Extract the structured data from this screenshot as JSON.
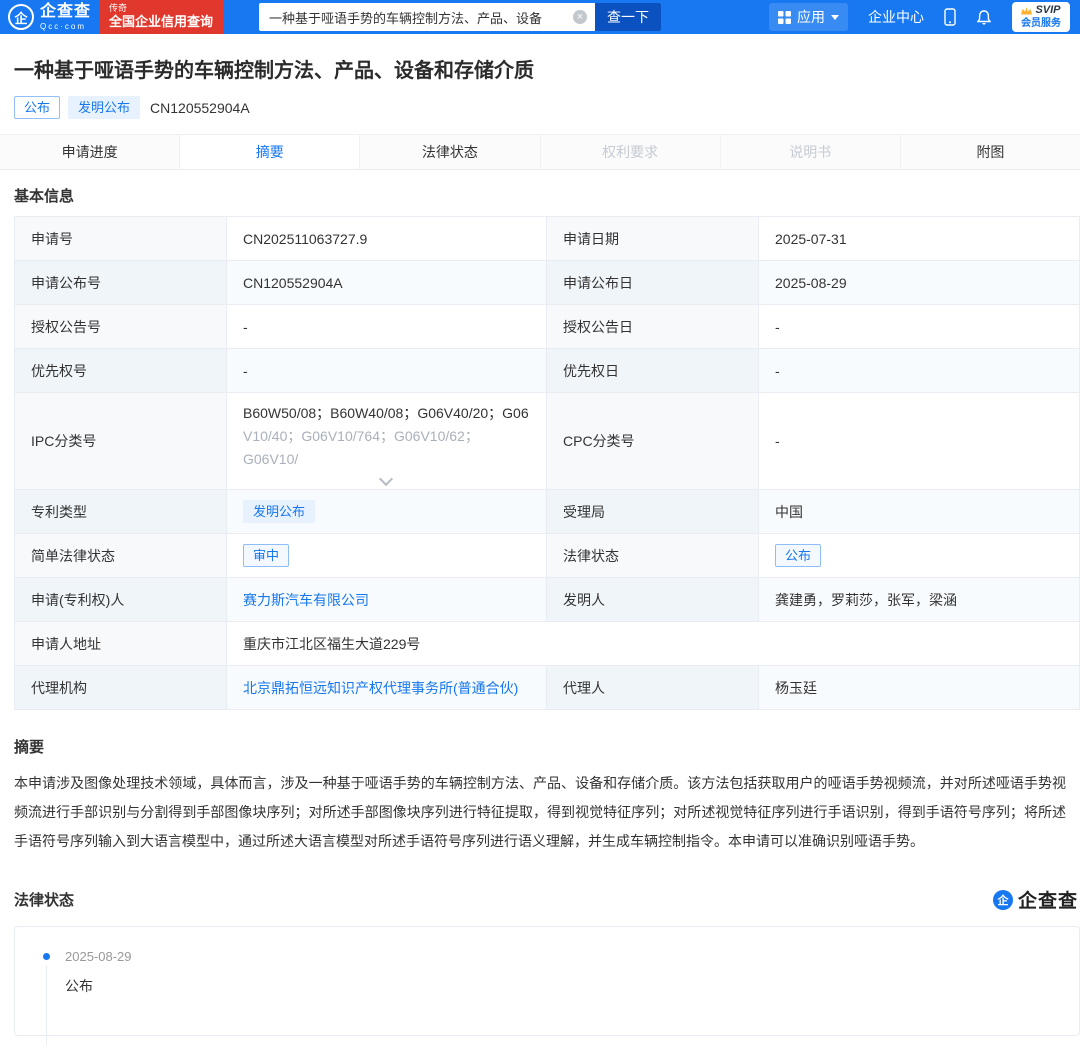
{
  "colors": {
    "header_blue": "#1778F2",
    "brand_blue": "#1677F0",
    "promo_red": "#E0382C",
    "search_button_blue": "#0B51C0"
  },
  "icons": {
    "clear": "×"
  },
  "header": {
    "logo": {
      "mark": "企",
      "name": "企查查",
      "domain": "Qcc·com"
    },
    "promo": {
      "small": "传奇",
      "main": "全国企业信用查询"
    },
    "search": {
      "value": "一种基于哑语手势的车辆控制方法、产品、设备",
      "button": "查一下"
    },
    "nav": {
      "apps": "应用",
      "center": "企业中心",
      "svip_top": "SVIP",
      "svip_bottom": "会员服务"
    }
  },
  "patent": {
    "title": "一种基于哑语手势的车辆控制方法、产品、设备和存储介质",
    "tag_outline": "公布",
    "tag_solid": "发明公布",
    "number": "CN120552904A"
  },
  "tabs": [
    {
      "label": "申请进度"
    },
    {
      "label": "摘要"
    },
    {
      "label": "法律状态"
    },
    {
      "label": "权利要求"
    },
    {
      "label": "说明书"
    },
    {
      "label": "附图"
    }
  ],
  "basic": {
    "title": "基本信息",
    "rows": [
      {
        "l1": "申请号",
        "v1": "CN202511063727.9",
        "l2": "申请日期",
        "v2": "2025-07-31"
      },
      {
        "l1": "申请公布号",
        "v1": "CN120552904A",
        "l2": "申请公布日",
        "v2": "2025-08-29"
      },
      {
        "l1": "授权公告号",
        "v1": "-",
        "l2": "授权公告日",
        "v2": "-"
      },
      {
        "l1": "优先权号",
        "v1": "-",
        "l2": "优先权日",
        "v2": "-"
      },
      {
        "l1": "IPC分类号",
        "v1_line1": "B60W50/08；B60W40/08；G06V40/20；G06",
        "v1_line2": "V10/40；G06V10/764；G06V10/62；G06V10/",
        "l2": "CPC分类号",
        "v2": "-"
      },
      {
        "l1": "专利类型",
        "v1_tag": "发明公布",
        "l2": "受理局",
        "v2": "中国"
      },
      {
        "l1": "简单法律状态",
        "v1_tag": "审中",
        "l2": "法律状态",
        "v2_tag": "公布"
      },
      {
        "l1": "申请(专利权)人",
        "v1_link": "赛力斯汽车有限公司",
        "l2": "发明人",
        "v2": "龚建勇，罗莉莎，张军，梁涵"
      },
      {
        "l1": "申请人地址",
        "v1": "重庆市江北区福生大道229号"
      },
      {
        "l1": "代理机构",
        "v1_link": "北京鼎拓恒远知识产权代理事务所(普通合伙)",
        "l2": "代理人",
        "v2": "杨玉廷"
      }
    ]
  },
  "abstract": {
    "title": "摘要",
    "text": "本申请涉及图像处理技术领域，具体而言，涉及一种基于哑语手势的车辆控制方法、产品、设备和存储介质。该方法包括获取用户的哑语手势视频流，并对所述哑语手势视频流进行手部识别与分割得到手部图像块序列；对所述手部图像块序列进行特征提取，得到视觉特征序列；对所述视觉特征序列进行手语识别，得到手语符号序列；将所述手语符号序列输入到大语言模型中，通过所述大语言模型对所述手语符号序列进行语义理解，并生成车辆控制指令。本申请可以准确识别哑语手势。"
  },
  "legal": {
    "title": "法律状态",
    "brand_mark": "企",
    "brand_text": "企查查",
    "events": [
      {
        "date": "2025-08-29",
        "status": "公布"
      }
    ]
  }
}
